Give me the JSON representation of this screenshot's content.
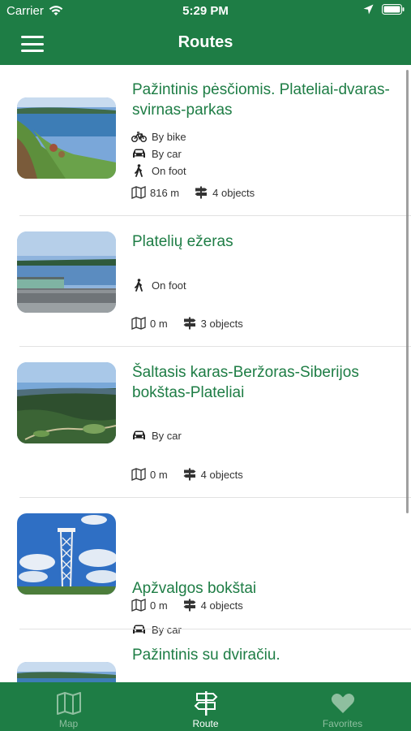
{
  "status": {
    "carrier": "Carrier",
    "time": "5:29 PM"
  },
  "navbar": {
    "title": "Routes"
  },
  "routes": [
    {
      "title": "Pažintinis pėsčiomis. Plateliai-dvaras-svirnas-parkas",
      "modes": [
        {
          "icon": "bike-icon",
          "label": "By bike"
        },
        {
          "icon": "car-icon",
          "label": "By car"
        },
        {
          "icon": "walk-icon",
          "label": "On foot"
        }
      ],
      "distance": "816 m",
      "objects": "4 objects"
    },
    {
      "title": "Platelių ežeras",
      "modes": [
        {
          "icon": "walk-icon",
          "label": "On foot"
        }
      ],
      "distance": "0 m",
      "objects": "3 objects"
    },
    {
      "title": "Šaltasis karas-Beržoras-Siberijos bokštas-Plateliai",
      "modes": [
        {
          "icon": "car-icon",
          "label": "By car"
        }
      ],
      "distance": "0 m",
      "objects": "4 objects"
    },
    {
      "title": "Apžvalgos bokštai",
      "modes": [
        {
          "icon": "car-icon",
          "label": "By car"
        }
      ],
      "distance": "0 m",
      "objects": "4 objects"
    },
    {
      "title": "Pažintinis su dviračiu."
    }
  ],
  "tabs": [
    {
      "label": "Map",
      "icon": "map-icon",
      "active": false
    },
    {
      "label": "Route",
      "icon": "signpost-icon",
      "active": true
    },
    {
      "label": "Favorites",
      "icon": "heart-icon",
      "active": false
    }
  ],
  "colors": {
    "brand": "#1e7d45",
    "tab_inactive": "#8ebf9f"
  }
}
